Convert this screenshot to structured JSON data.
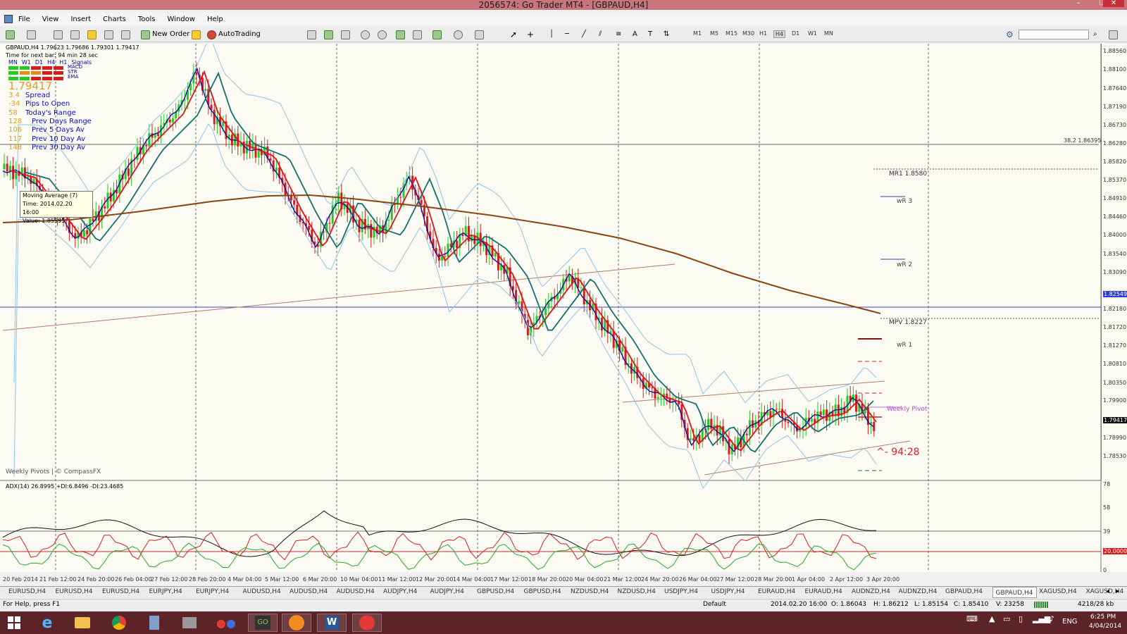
{
  "window": {
    "title": "2056574: Go Trader MT4 - [GBPAUD,H4]",
    "minimize_glyph": "–",
    "restore_glyph": "❐",
    "close_glyph": "✕"
  },
  "menu": [
    "File",
    "View",
    "Insert",
    "Charts",
    "Tools",
    "Window",
    "Help"
  ],
  "toolbar": {
    "new_order": "New Order",
    "autotrading": "AutoTrading",
    "timeframes": [
      "M1",
      "M5",
      "M15",
      "M30",
      "H1",
      "H4",
      "D1",
      "W1",
      "MN"
    ],
    "active_timeframe": "H4"
  },
  "chart": {
    "header": "GBPAUD,H4 1.79623 1.79686 1.79301 1.79417",
    "timer": "Time for next bar: 94 min 28 sec",
    "signal_headers": [
      "MN",
      "W1",
      "D1",
      "H4",
      "H1",
      "Signals"
    ],
    "signal_labels": [
      "MACD",
      "STR",
      "EMA"
    ],
    "big_price": "1.79417",
    "stats": [
      {
        "value": "3.4",
        "label": "Spread"
      },
      {
        "value": "-34",
        "label": "Pips to Open"
      },
      {
        "value": "58",
        "label": "Today's Range"
      },
      {
        "value": "128",
        "label": "Prev Days Range"
      },
      {
        "value": "106",
        "label": "Prev 5 Days Av"
      },
      {
        "value": "117",
        "label": "Prev 10 Day Av"
      },
      {
        "value": "148",
        "label": "Prev 30 Day Av"
      }
    ],
    "tooltip": {
      "line1": "Moving Average (7)",
      "line2": "Time: 2014.02.20 16:00",
      "line3": "Value: 1.85595"
    },
    "pivot_labels": {
      "mr1": "MR1  1.8580",
      "wr3": "wR 3",
      "wr2": "wR 2",
      "mpv": "MPV  1.8227",
      "wr1": "wR 1",
      "weekly_pivot": "Weekly Pivot"
    },
    "fib_label": "38.2  1.86395",
    "countdown": "^- 94:28",
    "footer_credit": "Weekly Pivots | © CompassFX",
    "price_axis": [
      "1.88560",
      "1.88100",
      "1.87640",
      "1.87190",
      "1.86730",
      "1.86280",
      "1.85820",
      "1.85370",
      "1.84910",
      "1.84460",
      "1.84000",
      "1.83540",
      "1.83090",
      "1.82549",
      "1.82180",
      "1.81720",
      "1.81270",
      "1.80810",
      "1.80350",
      "1.79900",
      "1.79417",
      "1.78990",
      "1.78530"
    ],
    "current_price": "1.79417",
    "hline_price": "1.82549",
    "colors": {
      "bull": "#22cc22",
      "bear": "#d81b1b",
      "ma_red": "#e0101c",
      "ma_blue": "#1010a0",
      "ma_teal": "#127070",
      "ma_brown": "#8b4513",
      "bands": "#8fc3e8",
      "hline": "#4040c0"
    }
  },
  "adx": {
    "header": "ADX(14) 26.8995 +DI:6.8496 -DI:23.4685",
    "axis": [
      "78",
      "58",
      "39",
      "20.0000",
      "0"
    ]
  },
  "time_axis": [
    "20 Feb 2014",
    "21 Feb 12:00",
    "24 Feb 20:00",
    "26 Feb 04:00",
    "27 Feb 12:00",
    "28 Feb 20:00",
    "4 Mar 04:00",
    "5 Mar 12:00",
    "6 Mar 20:00",
    "10 Mar 04:00",
    "11 Mar 12:00",
    "12 Mar 20:00",
    "14 Mar 04:00",
    "17 Mar 12:00",
    "18 Mar 20:00",
    "20 Mar 04:00",
    "21 Mar 12:00",
    "24 Mar 20:00",
    "26 Mar 04:00",
    "27 Mar 12:00",
    "28 Mar 20:00",
    "1 Apr 04:00",
    "2 Apr 12:00",
    "3 Apr 20:00"
  ],
  "tabs": [
    "EURUSD,H4",
    "EURUSD,H4",
    "EURUSD,H4",
    "EURJPY,H4",
    "EURJPY,H4",
    "AUDUSD,H4",
    "AUDUSD,H4",
    "AUDUSD,H4",
    "AUDJPY,H4",
    "AUDJPY,H4",
    "GBPUSD,H4",
    "GBPUSD,H4",
    "NZDUSD,H4",
    "NZDUSD,H4",
    "USDJPY,H4",
    "USDJPY,H4",
    "EURAUD,H4",
    "EURAUD,H4",
    "AUDNZD,H4",
    "AUDNZD,H4",
    "GBPAUD,H4",
    "GBPAUD,H4",
    "XAGUSD,H4",
    "XAGUSD,H4"
  ],
  "active_tab_index": 21,
  "status": {
    "help": "For Help, press F1",
    "profile": "Default",
    "datetime": "2014.02.20 16:00",
    "open": "O: 1.86043",
    "high": "H: 1.86212",
    "low": "L: 1.85154",
    "close": "C: 1.85410",
    "volume": "V: 23258",
    "traffic": "4218/28 kb"
  },
  "taskbar": {
    "lang": "ENG",
    "time": "6:25 PM",
    "date": "4/04/2014"
  }
}
